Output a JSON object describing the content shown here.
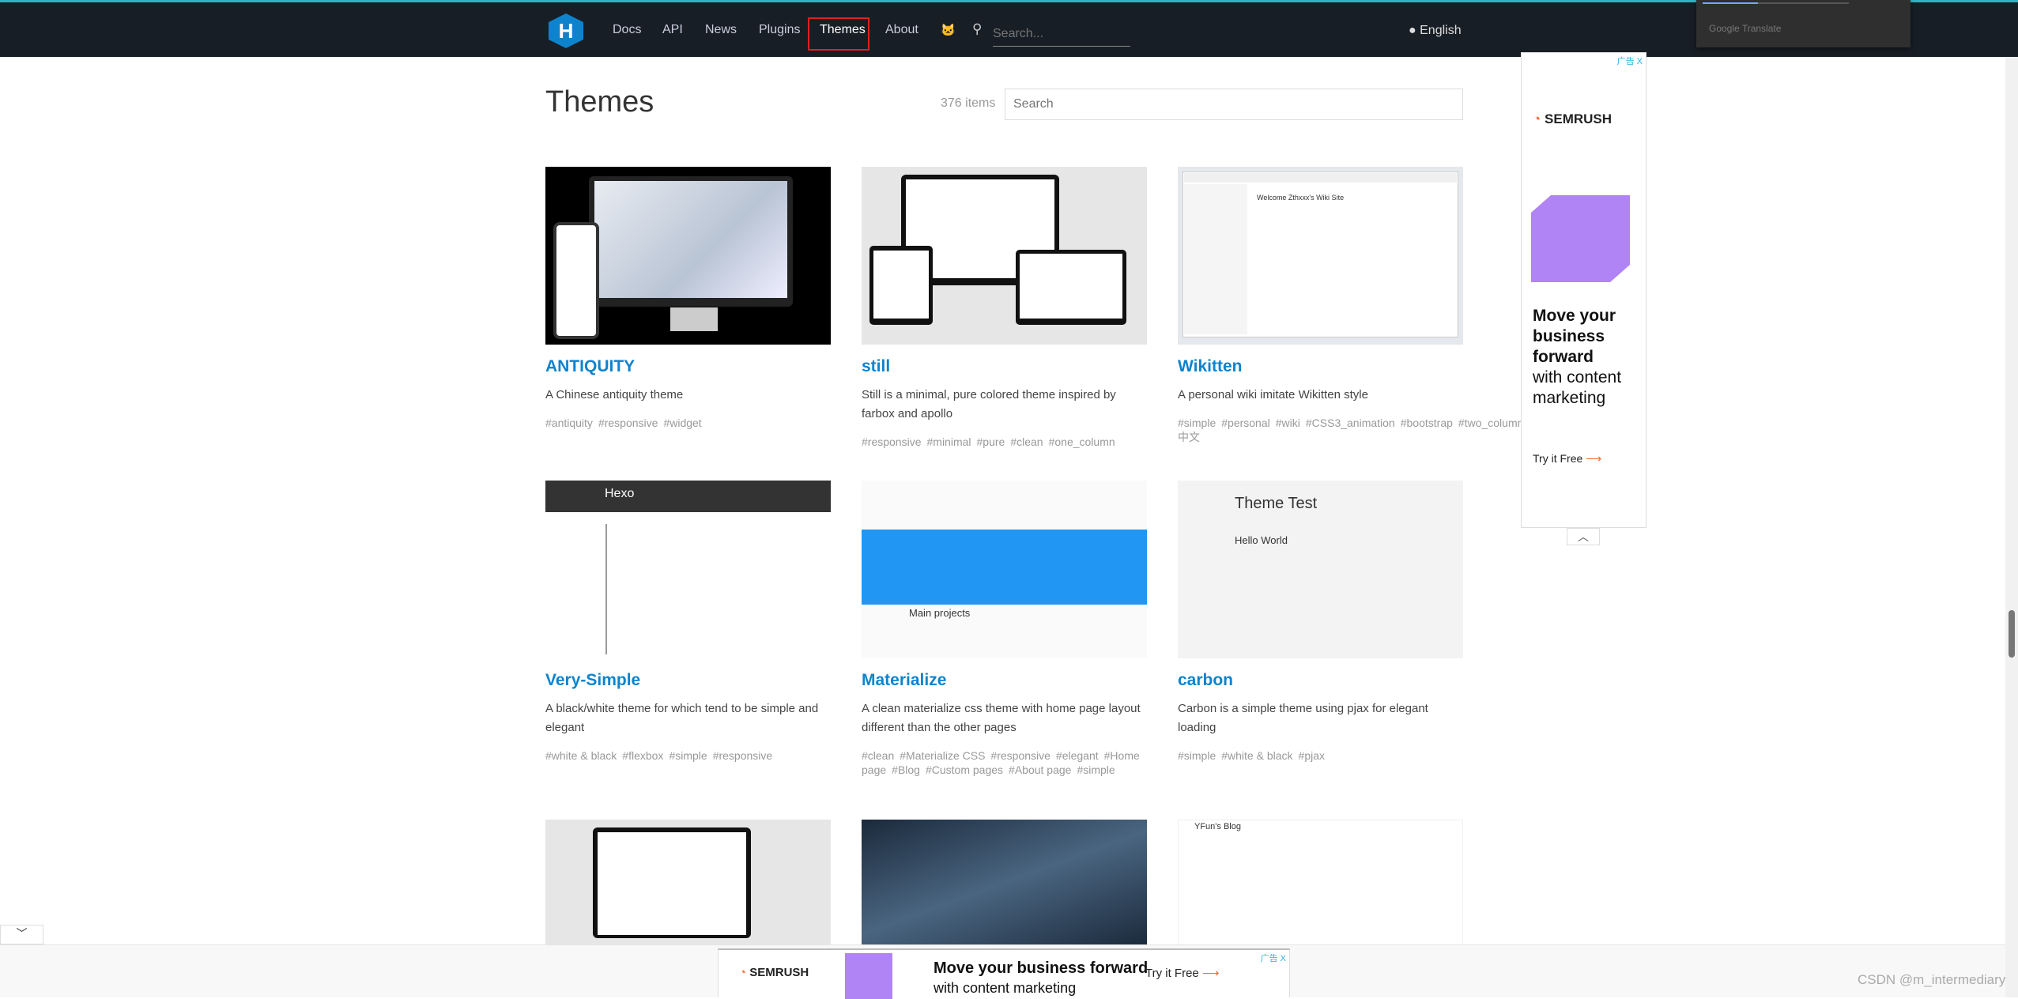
{
  "nav": {
    "logo": "H",
    "items": [
      "Docs",
      "API",
      "News",
      "Plugins",
      "Themes",
      "About"
    ],
    "active": "Themes",
    "search_placeholder": "Search...",
    "language": "English",
    "translate": "Google Translate"
  },
  "page": {
    "title": "Themes",
    "count": "376 items",
    "search_placeholder": "Search"
  },
  "themes": [
    {
      "name": "ANTIQUITY",
      "desc": "A Chinese antiquity theme",
      "tags": [
        "#antiquity",
        "#responsive",
        "#widget"
      ]
    },
    {
      "name": "still",
      "desc": "Still is a minimal, pure colored theme inspired by farbox and apollo",
      "tags": [
        "#responsive",
        "#minimal",
        "#pure",
        "#clean",
        "#one_column"
      ]
    },
    {
      "name": "Wikitten",
      "desc": "A personal wiki imitate Wikitten style",
      "tags": [
        "#simple",
        "#personal",
        "#wiki",
        "#CSS3_animation",
        "#bootstrap",
        "#two_columns",
        "#中文"
      ]
    },
    {
      "name": "Very-Simple",
      "desc": "A black/white theme for which tend to be simple and elegant",
      "tags": [
        "#white & black",
        "#flexbox",
        "#simple",
        "#responsive"
      ]
    },
    {
      "name": "Materialize",
      "desc": "A clean materialize css theme with home page layout different than the other pages",
      "tags": [
        "#clean",
        "#Materialize CSS",
        "#responsive",
        "#elegant",
        "#Home page",
        "#Blog",
        "#Custom pages",
        "#About page",
        "#simple"
      ]
    },
    {
      "name": "carbon",
      "desc": "Carbon is a simple theme using pjax for elegant loading",
      "tags": [
        "#simple",
        "#white & black",
        "#pjax"
      ]
    }
  ],
  "thumb_texts": {
    "wikitten": "Welcome Zthxxx's Wiki Site",
    "verysimple": "Hexo",
    "materialize": "Main projects",
    "carbon": "Theme Test",
    "carbon_post": "Hello World",
    "yfun": "YFun's Blog"
  },
  "ad": {
    "label": "广告 X",
    "brand": "SEMRUSH",
    "headline_bold": "Move your business forward",
    "headline_rest": "with content marketing",
    "cta": "Try it Free",
    "right_l1": "Move your",
    "right_l2": "business",
    "right_l3": "forward",
    "right_l4": "with content",
    "right_l5": "marketing"
  },
  "watermark": "CSDN @m_intermediary",
  "colors": {
    "nav_bg": "#171e26",
    "accent": "#0e83cd",
    "active_outline": "#e02020"
  }
}
